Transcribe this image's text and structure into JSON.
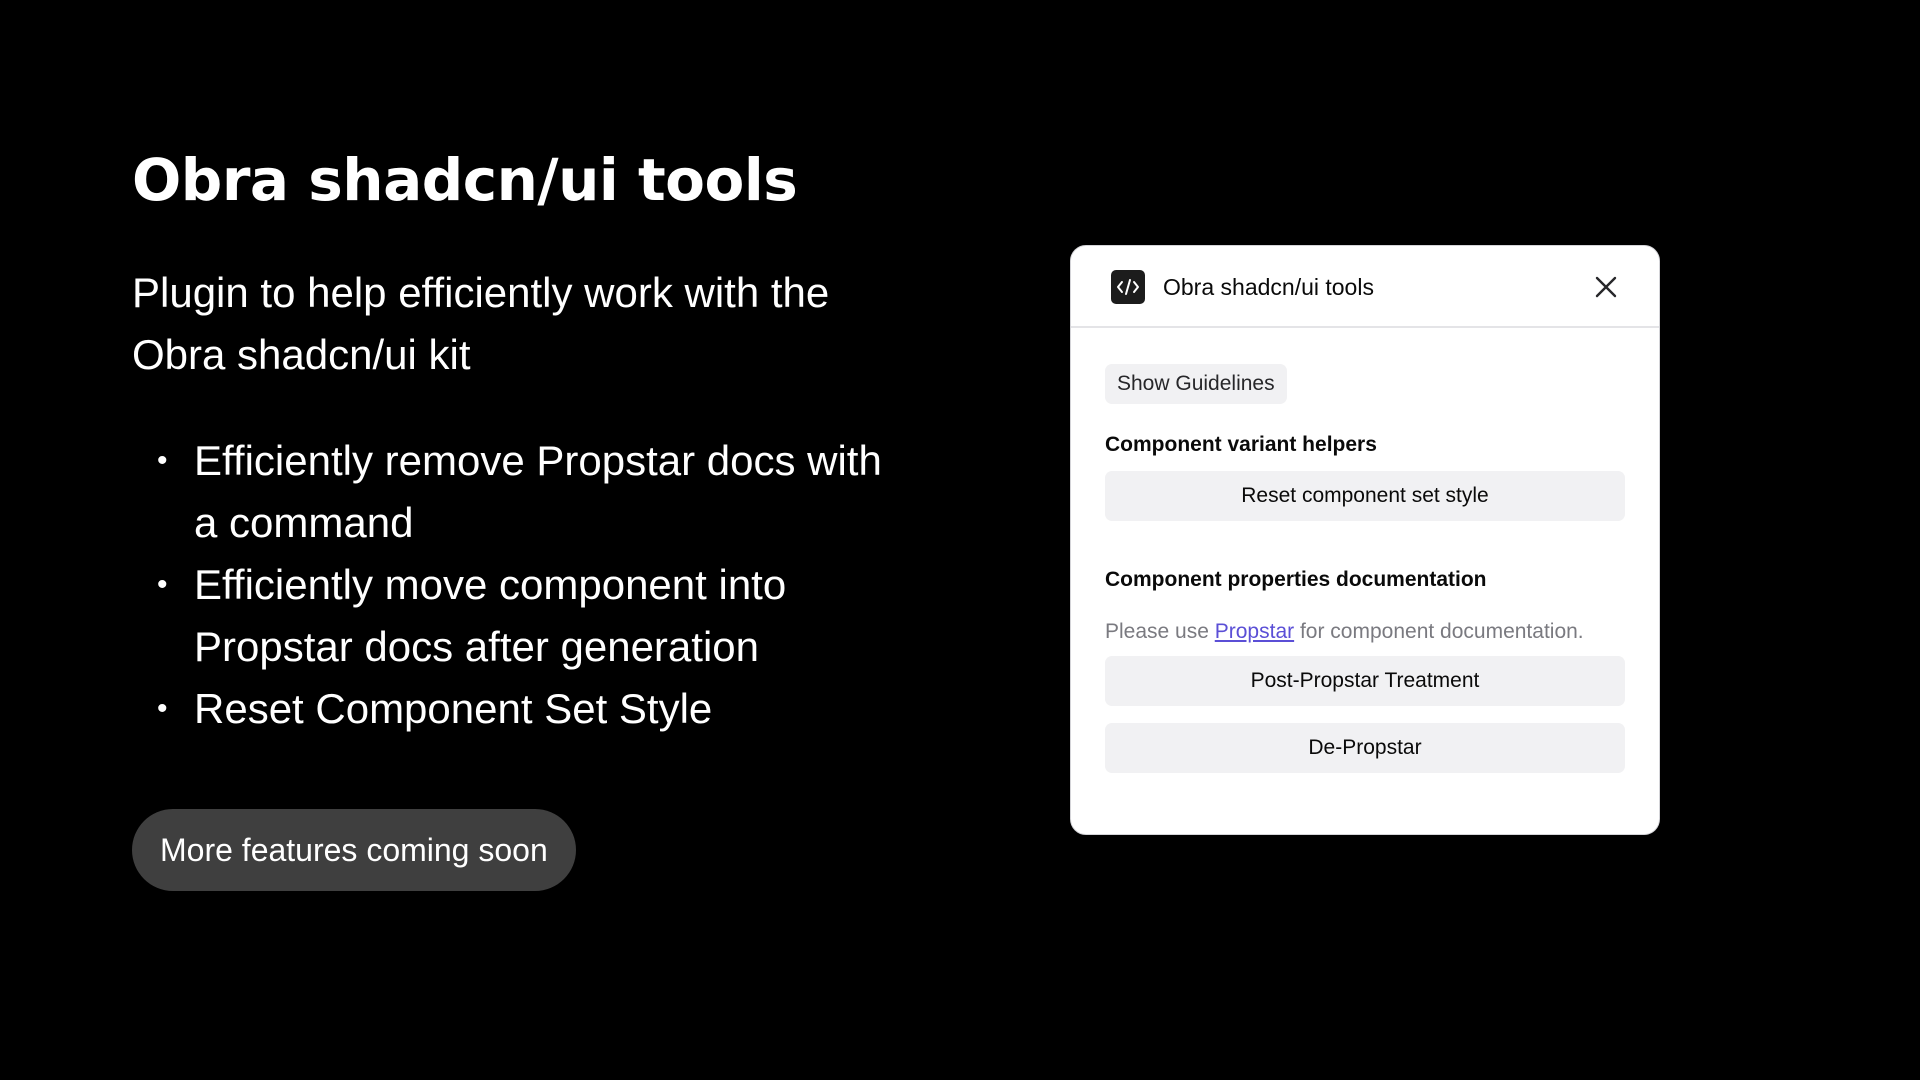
{
  "slide": {
    "title": "Obra shadcn/ui tools",
    "subtitle_line1": "Plugin to help efficiently work with the",
    "subtitle_line2": "Obra shadcn/ui kit",
    "features": [
      {
        "line1": "Efficiently remove Propstar docs with",
        "line2": "a command"
      },
      {
        "line1": "Efficiently move component into",
        "line2": "Propstar docs after generation"
      },
      {
        "line1": "Reset Component Set Style",
        "line2": ""
      }
    ],
    "bullet_glyph": "•",
    "coming_soon": "More features coming soon"
  },
  "plugin": {
    "title": "Obra shadcn/ui tools",
    "app_icon": "code-icon",
    "close_icon": "close-icon",
    "show_guidelines": "Show Guidelines",
    "variant_helpers_heading": "Component variant helpers",
    "reset_button": "Reset component set style",
    "properties_heading": "Component properties documentation",
    "note_prefix": "Please use ",
    "note_link": "Propstar",
    "note_suffix": " for component documentation.",
    "post_propstar_button": "Post-Propstar Treatment",
    "de_propstar_button": "De-Propstar"
  },
  "colors": {
    "background": "#000000",
    "pill": "#3f3f3f",
    "link": "#5b4fd6",
    "button_bg": "#f1f1f3"
  }
}
